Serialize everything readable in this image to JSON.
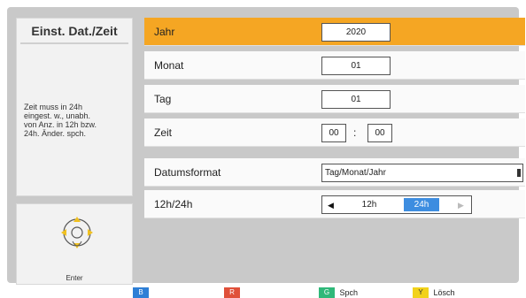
{
  "title": "Einst. Dat./Zeit",
  "hint_lines": [
    "Zeit muss in 24h",
    "eingest. w., unabh.",
    "von Anz. in 12h bzw.",
    "24h. Änder. spch."
  ],
  "nav": {
    "enter_label": "Enter"
  },
  "rows": {
    "jahr": {
      "label": "Jahr",
      "value": "2020"
    },
    "monat": {
      "label": "Monat",
      "value": "01"
    },
    "tag": {
      "label": "Tag",
      "value": "01"
    },
    "zeit": {
      "label": "Zeit",
      "hours": "00",
      "colon": ":",
      "minutes": "00"
    },
    "datumsformat": {
      "label": "Datumsformat",
      "value": "Tag/Monat/Jahr"
    },
    "stunden": {
      "label": "12h/24h",
      "option_12": "12h",
      "option_24": "24h",
      "selected": "24h"
    }
  },
  "keys": [
    {
      "letter": "B",
      "color": "#2e7fd6",
      "text_color": "#ffffff",
      "label": ""
    },
    {
      "letter": "R",
      "color": "#e0503a",
      "text_color": "#ffffff",
      "label": ""
    },
    {
      "letter": "G",
      "color": "#2fb879",
      "text_color": "#ffffff",
      "label": "Spch"
    },
    {
      "letter": "Y",
      "color": "#f2d21b",
      "text_color": "#333333",
      "label": "Lösch"
    }
  ],
  "colors": {
    "selected_row": "#f5a623",
    "toggle_active": "#3d8de0"
  }
}
